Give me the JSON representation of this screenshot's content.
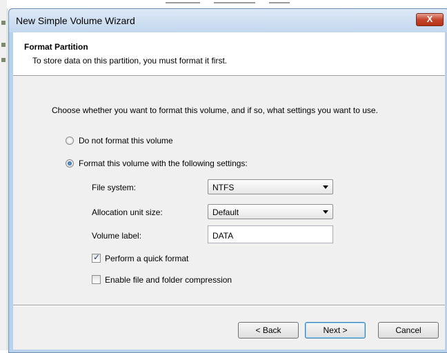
{
  "window": {
    "title": "New Simple Volume Wizard",
    "close_glyph": "X"
  },
  "header": {
    "title": "Format Partition",
    "subtitle": "To store data on this partition, you must format it first."
  },
  "instructions": "Choose whether you want to format this volume, and if so, what settings you want to use.",
  "options": {
    "no_format": {
      "label": "Do not format this volume",
      "selected": false
    },
    "format": {
      "label": "Format this volume with the following settings:",
      "selected": true
    }
  },
  "settings": {
    "file_system": {
      "label": "File system:",
      "value": "NTFS"
    },
    "allocation_unit_size": {
      "label": "Allocation unit size:",
      "value": "Default"
    },
    "volume_label": {
      "label": "Volume label:",
      "value": "DATA"
    }
  },
  "checkboxes": {
    "quick_format": {
      "label": "Perform a quick format",
      "checked": true
    },
    "compression": {
      "label": "Enable file and folder compression",
      "checked": false
    }
  },
  "buttons": {
    "back": "< Back",
    "next": "Next >",
    "cancel": "Cancel"
  },
  "colors": {
    "title_bar": "#c2d7ee",
    "close_button": "#c4452c",
    "client_bg": "#f0f0f0",
    "header_bg": "#ffffff"
  },
  "icons": {
    "close": "close-icon",
    "dropdown": "chevron-down-icon"
  }
}
